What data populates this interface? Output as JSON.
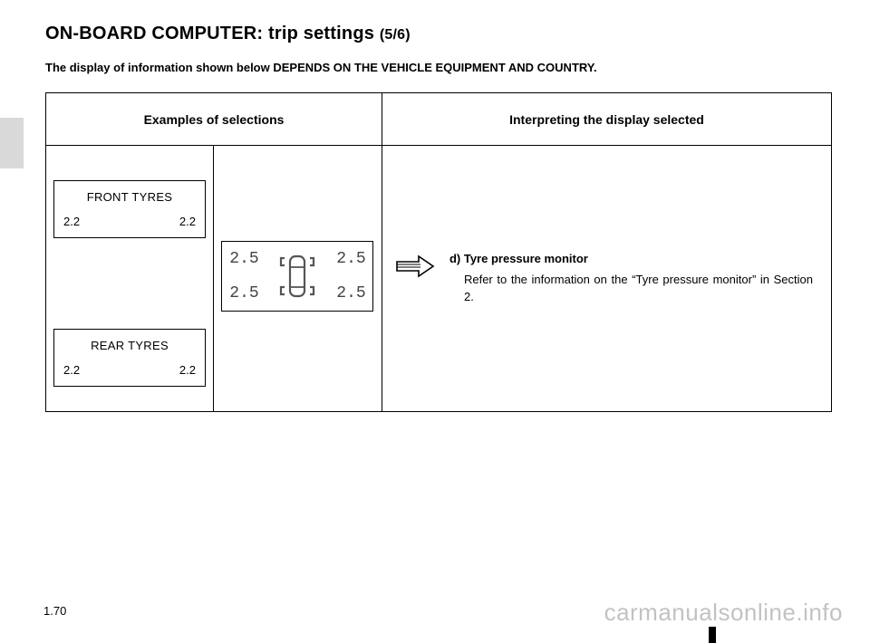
{
  "title_main": "ON-BOARD COMPUTER: trip settings",
  "title_part": "(5/6)",
  "disclaimer": "The display of information shown below DEPENDS ON THE VEHICLE EQUIPMENT AND COUNTRY.",
  "table": {
    "header_left": "Examples of selections",
    "header_right": "Interpreting the display selected"
  },
  "front_box": {
    "title": "FRONT TYRES",
    "left": "2.2",
    "right": "2.2"
  },
  "rear_box": {
    "title": "REAR TYRES",
    "left": "2.2",
    "right": "2.2"
  },
  "lcd": {
    "front_left": "2.5",
    "front_right": "2.5",
    "rear_left": "2.5",
    "rear_right": "2.5"
  },
  "interpretation": {
    "head": "d) Tyre pressure monitor",
    "body": "Refer to the information on the “Tyre pressure monitor” in Section 2."
  },
  "page_number": "1.70",
  "watermark": "carmanualsonline.info"
}
